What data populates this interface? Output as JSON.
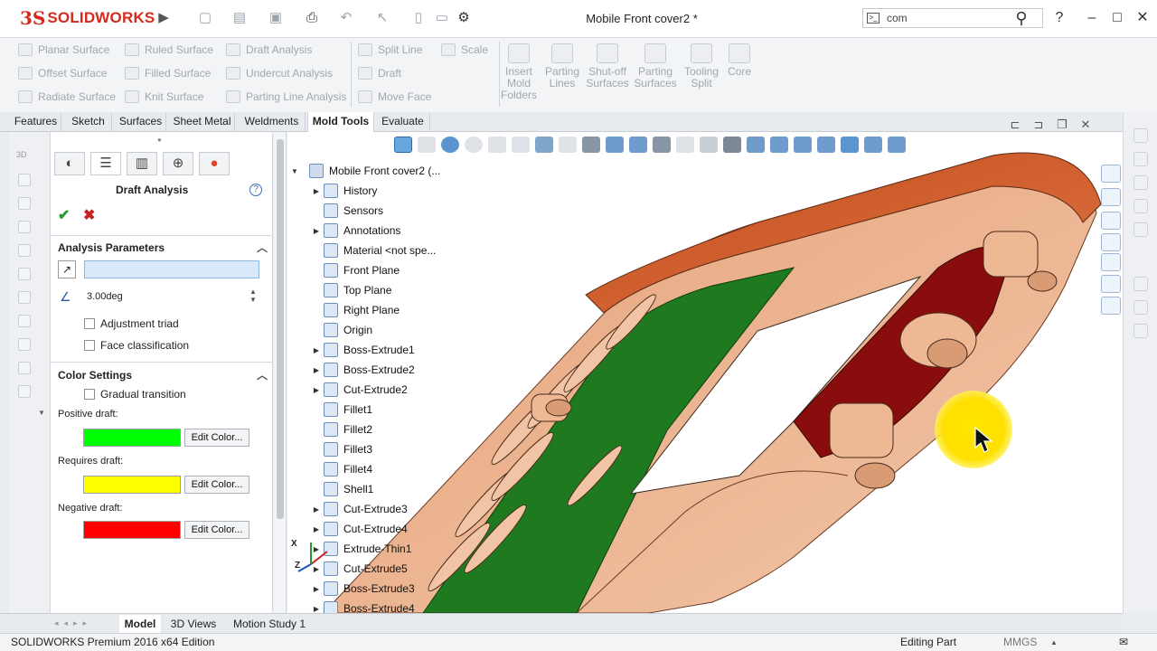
{
  "app": {
    "logo_ds": "3S",
    "logo_text": "SOLIDWORKS",
    "document_title": "Mobile Front cover2 *",
    "search_value": "com"
  },
  "ribbon": {
    "col1": [
      "Planar Surface",
      "Offset Surface",
      "Radiate Surface"
    ],
    "col2": [
      "Ruled Surface",
      "Filled Surface",
      "Knit Surface"
    ],
    "col3": [
      "Draft Analysis",
      "Undercut Analysis",
      "Parting Line Analysis"
    ],
    "col4": [
      "Split Line",
      "Draft",
      "Move Face"
    ],
    "col4b": "Scale",
    "big": [
      "Insert Mold Folders",
      "Parting Lines",
      "Shut-off Surfaces",
      "Parting Surfaces",
      "Tooling Split",
      "Core"
    ]
  },
  "command_tabs": [
    "Features",
    "Sketch",
    "Surfaces",
    "Sheet Metal",
    "Weldments",
    "Mold Tools",
    "Evaluate"
  ],
  "active_command_tab": "Mold Tools",
  "property_manager": {
    "title": "Draft Analysis",
    "analysis_parameters": {
      "heading": "Analysis Parameters",
      "selected_face": "",
      "draft_angle": "3.00deg",
      "adjustment_triad": "Adjustment triad",
      "face_classification": "Face classification"
    },
    "color_settings": {
      "heading": "Color Settings",
      "gradual_transition": "Gradual transition",
      "positive_label": "Positive draft:",
      "positive_color": "#00ff00",
      "requires_label": "Requires draft:",
      "requires_color": "#ffff00",
      "negative_label": "Negative draft:",
      "negative_color": "#ff0000",
      "edit_color_label": "Edit Color..."
    }
  },
  "feature_tree": {
    "root": "Mobile Front cover2  (...",
    "items": [
      {
        "label": "History",
        "expandable": true
      },
      {
        "label": "Sensors",
        "expandable": false
      },
      {
        "label": "Annotations",
        "expandable": true
      },
      {
        "label": "Material <not spe...",
        "expandable": false
      },
      {
        "label": "Front Plane",
        "expandable": false
      },
      {
        "label": "Top Plane",
        "expandable": false
      },
      {
        "label": "Right Plane",
        "expandable": false
      },
      {
        "label": "Origin",
        "expandable": false
      },
      {
        "label": "Boss-Extrude1",
        "expandable": true
      },
      {
        "label": "Boss-Extrude2",
        "expandable": true
      },
      {
        "label": "Cut-Extrude2",
        "expandable": true
      },
      {
        "label": "Fillet1",
        "expandable": false
      },
      {
        "label": "Fillet2",
        "expandable": false
      },
      {
        "label": "Fillet3",
        "expandable": false
      },
      {
        "label": "Fillet4",
        "expandable": false
      },
      {
        "label": "Shell1",
        "expandable": false
      },
      {
        "label": "Cut-Extrude3",
        "expandable": true
      },
      {
        "label": "Cut-Extrude4",
        "expandable": true
      },
      {
        "label": "Extrude-Thin1",
        "expandable": true
      },
      {
        "label": "Cut-Extrude5",
        "expandable": true
      },
      {
        "label": "Boss-Extrude3",
        "expandable": true
      },
      {
        "label": "Boss-Extrude4",
        "expandable": true
      }
    ]
  },
  "bottom_tabs": [
    "Model",
    "3D Views",
    "Motion Study 1"
  ],
  "active_bottom_tab": "Model",
  "status": {
    "edition": "SOLIDWORKS Premium 2016 x64 Edition",
    "mode": "Editing Part",
    "units": "MMGS"
  },
  "triad": {
    "x": "X",
    "z": "Z"
  }
}
